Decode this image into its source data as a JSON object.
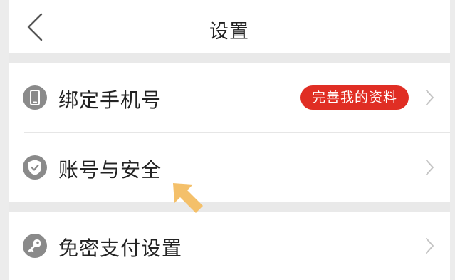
{
  "header": {
    "title": "设置",
    "back_icon": "chevron-left-icon"
  },
  "settings": {
    "items": [
      {
        "label": "绑定手机号",
        "icon": "phone-icon",
        "badge": "完善我的资料"
      },
      {
        "label": "账号与安全",
        "icon": "shield-check-icon"
      },
      {
        "label": "免密支付设置",
        "icon": "key-icon"
      }
    ]
  },
  "colors": {
    "badge": "#e02e24",
    "icon": "#8a8a8a",
    "pointer_arrow": "#f4c06a",
    "separator": "#e9e9e9"
  }
}
